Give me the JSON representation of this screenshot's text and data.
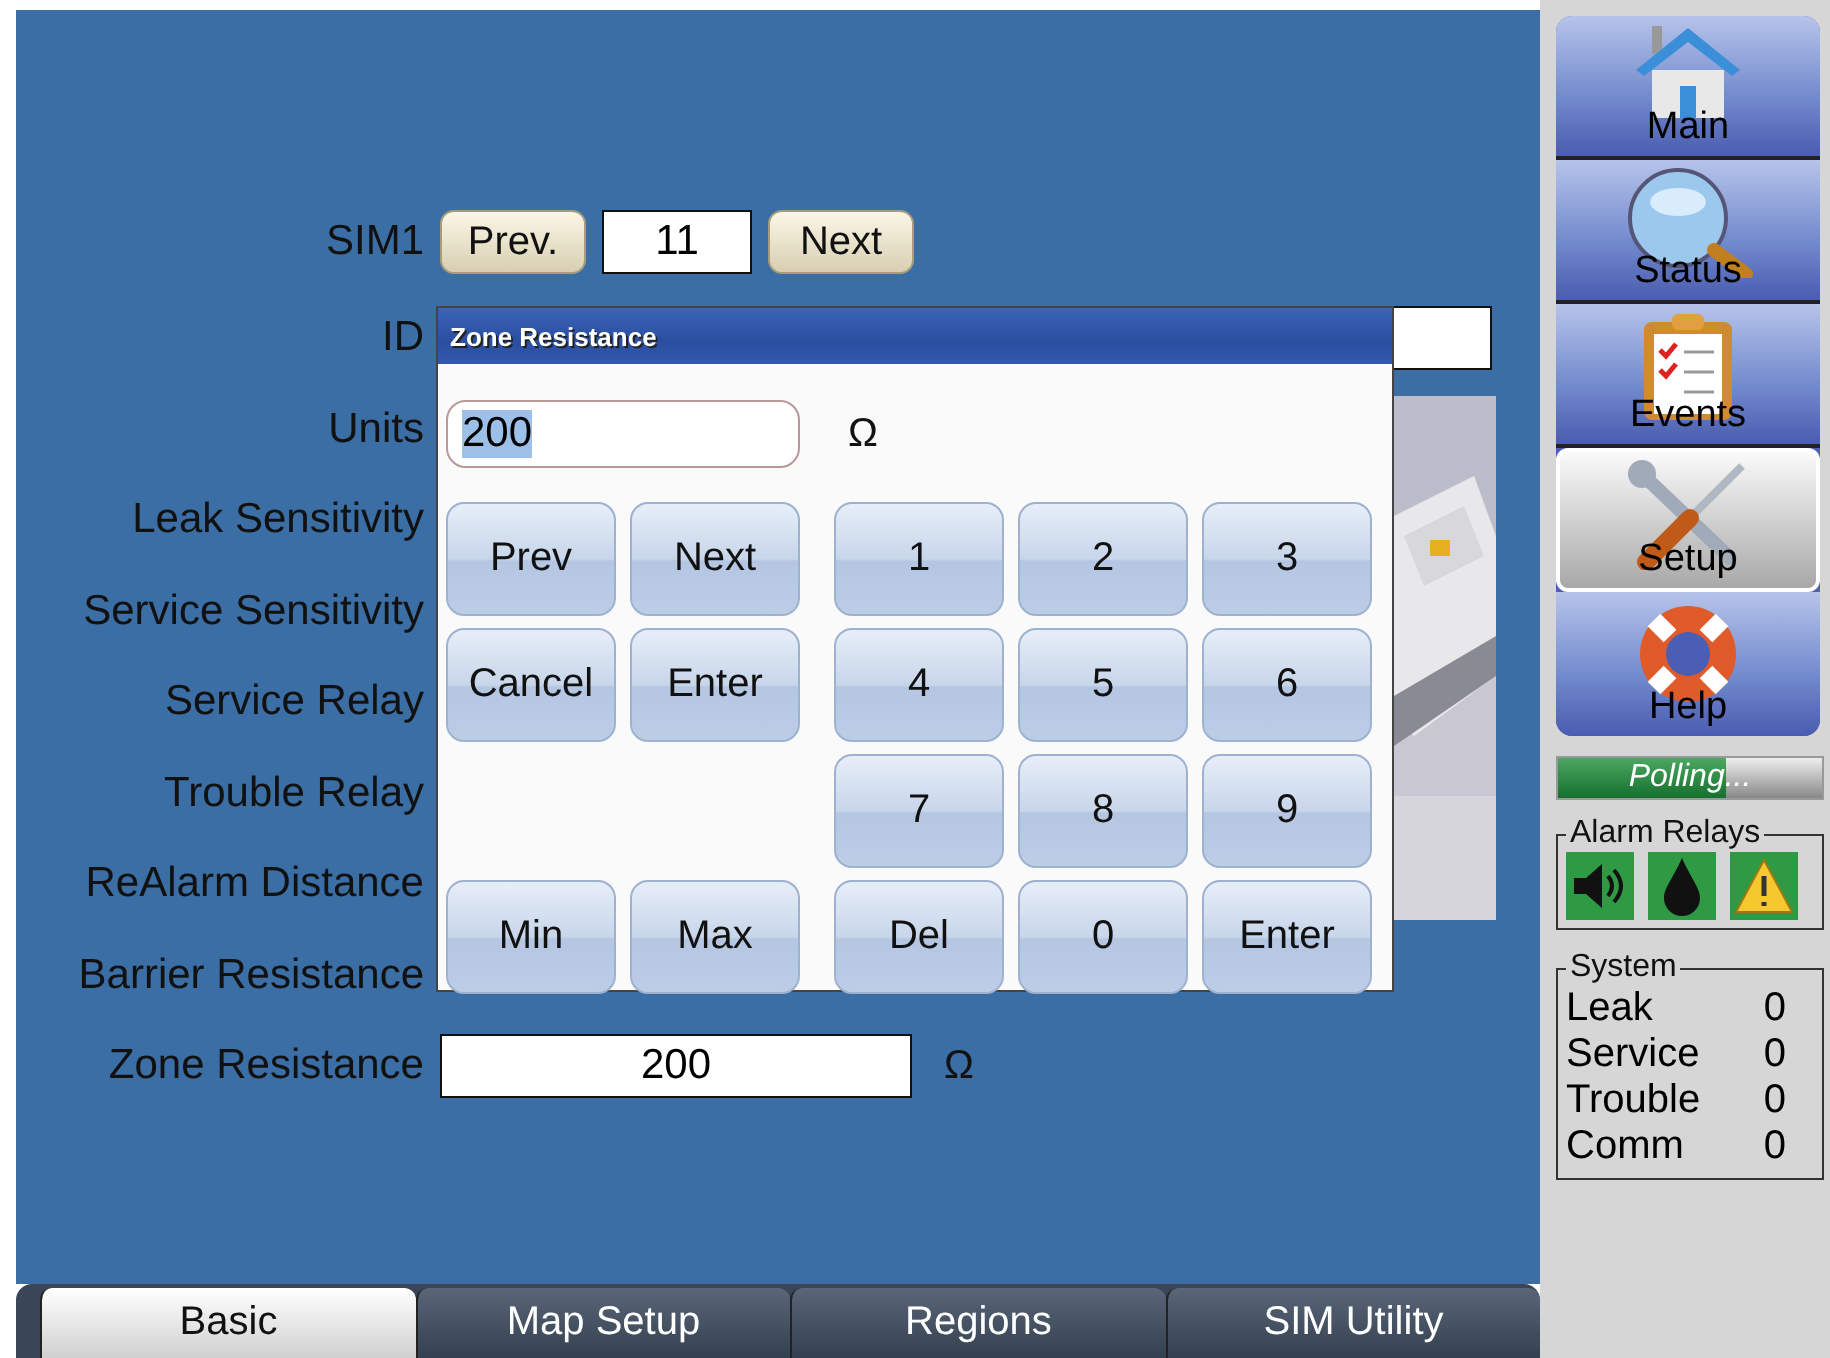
{
  "form": {
    "sim_label": "SIM1",
    "prev_button": "Prev.",
    "sim_number": "11",
    "next_button": "Next",
    "labels": [
      "ID",
      "Units",
      "Leak Sensitivity",
      "Service Sensitivity",
      "Service Relay",
      "Trouble Relay",
      "ReAlarm Distance",
      "Barrier Resistance",
      "Zone Resistance"
    ],
    "zone_resistance": {
      "value": "200",
      "unit": "Ω"
    }
  },
  "dialog": {
    "title": "Zone Resistance",
    "input": {
      "value": "200",
      "text_selected": true
    },
    "unit": "Ω",
    "side_keys": [
      "Prev",
      "Next",
      "Cancel",
      "Enter",
      "Min",
      "Max"
    ],
    "numpad": [
      "1",
      "2",
      "3",
      "4",
      "5",
      "6",
      "7",
      "8",
      "9",
      "Del",
      "0",
      "Enter"
    ]
  },
  "tabs": [
    {
      "label": "Basic",
      "selected": true
    },
    {
      "label": "Map Setup",
      "selected": false
    },
    {
      "label": "Regions",
      "selected": false
    },
    {
      "label": "SIM Utility",
      "selected": false
    }
  ],
  "nav": [
    {
      "label": "Main",
      "selected": false
    },
    {
      "label": "Status",
      "selected": false
    },
    {
      "label": "Events",
      "selected": false
    },
    {
      "label": "Setup",
      "selected": true
    },
    {
      "label": "Help",
      "selected": false
    }
  ],
  "polling": {
    "label": "Polling...",
    "level": 0.64
  },
  "alarm_relays": {
    "title": "Alarm Relays"
  },
  "system": {
    "title": "System",
    "rows": [
      {
        "label": "Leak",
        "value": "0"
      },
      {
        "label": "Service",
        "value": "0"
      },
      {
        "label": "Trouble",
        "value": "0"
      },
      {
        "label": "Comm",
        "value": "0"
      }
    ]
  }
}
